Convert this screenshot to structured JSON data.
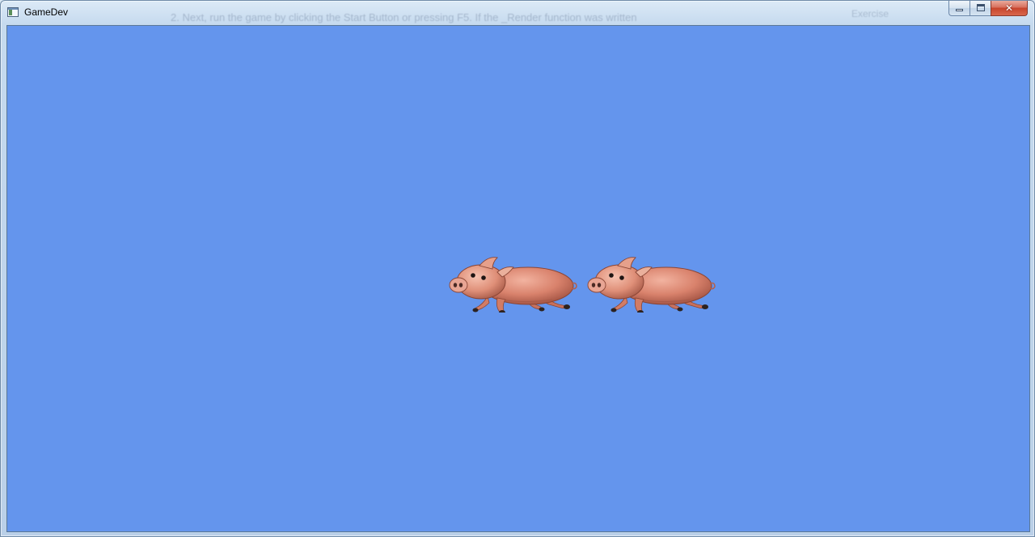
{
  "window": {
    "title": "GameDev",
    "background_color": "#6495ED"
  },
  "background_blur_text": {
    "line": "2.   Next, run the game by clicking the Start Button or pressing F5. If the _Render function was written",
    "right_text": "Exercise"
  },
  "caption_buttons": {
    "minimize_icon": "minimize-icon",
    "maximize_icon": "maximize-icon",
    "close_icon": "close-icon",
    "close_glyph": "✕"
  },
  "sprites": [
    {
      "name": "pig-sprite-1",
      "icon": "pig-icon"
    },
    {
      "name": "pig-sprite-2",
      "icon": "pig-icon"
    }
  ]
}
